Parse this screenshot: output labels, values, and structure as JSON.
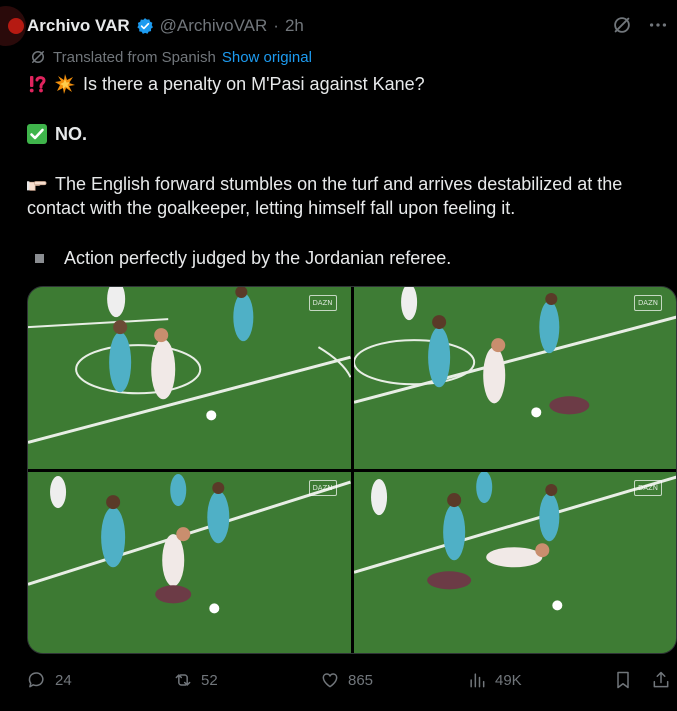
{
  "author": {
    "name": "Archivo VAR",
    "handle": "@ArchivoVAR",
    "separator": "·",
    "time": "2h"
  },
  "translation": {
    "note": "Translated from Spanish",
    "link": "Show original"
  },
  "post": {
    "line1": "Is there a penalty on M'Pasi against Kane?",
    "line2": "NO.",
    "line3": "The English forward stumbles on the turf and arrives destabilized at the contact with the goalkeeper, letting himself fall upon feeling it.",
    "line4": "Action perfectly judged by the Jordanian referee."
  },
  "media": {
    "watermark": "DAZN",
    "frames": 4
  },
  "actions": {
    "replies": "24",
    "reposts": "52",
    "likes": "865",
    "views": "49K"
  },
  "colors": {
    "background": "#000000",
    "text": "#e7e9ea",
    "muted": "#71767b",
    "link": "#1d9bf0",
    "verified": "#1d9bf0",
    "pitch": "#3f7a34"
  },
  "icons": [
    "verified-badge-icon",
    "grok-icon",
    "more-icon",
    "translate-icon",
    "reply-icon",
    "repost-icon",
    "like-icon",
    "views-icon",
    "bookmark-icon",
    "share-icon"
  ]
}
